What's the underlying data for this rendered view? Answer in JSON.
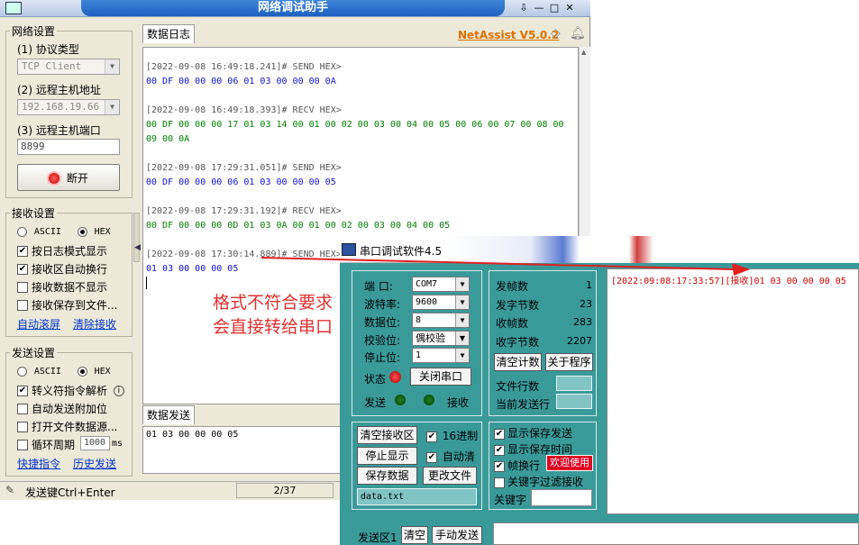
{
  "netassist": {
    "title": "网络调试助手",
    "brand": "NetAssist V5.0.2",
    "net_settings": {
      "label": "网络设置",
      "protocol_label": "(1) 协议类型",
      "protocol_value": "TCP Client",
      "host_label": "(2) 远程主机地址",
      "host_value": "192.168.19.66",
      "port_label": "(3) 远程主机端口",
      "port_value": "8899",
      "disconnect_label": "断开"
    },
    "recv_settings": {
      "label": "接收设置",
      "ascii": "ASCII",
      "hex": "HEX",
      "opt_log_mode": "按日志模式显示",
      "opt_auto_wrap": "接收区自动换行",
      "opt_no_display": "接收数据不显示",
      "opt_save_file": "接收保存到文件...",
      "link_auto_scroll": "自动滚屏",
      "link_clear": "清除接收"
    },
    "send_settings": {
      "label": "发送设置",
      "ascii": "ASCII",
      "hex": "HEX",
      "opt_escape": "转义符指令解析",
      "opt_append": "自动发送附加位",
      "opt_open_file": "打开文件数据源...",
      "opt_cycle": "循环周期",
      "cycle_value": "1000",
      "cycle_unit": "ms",
      "link_shortcut": "快捷指令",
      "link_history": "历史发送"
    },
    "log_tab": "数据日志",
    "log": [
      {
        "type": "hdr",
        "text": "[2022-09-08 16:49:18.241]# SEND HEX>"
      },
      {
        "type": "send",
        "text": "00 DF 00 00 00 06 01 03 00 00 00 0A"
      },
      {
        "type": "gap",
        "text": ""
      },
      {
        "type": "hdr",
        "text": "[2022-09-08 16:49:18.393]# RECV HEX>"
      },
      {
        "type": "recv",
        "text": "00 DF 00 00 00 17 01 03 14 00 01 00 02 00 03 00 04 00 05 00 06 00 07 00 08 00"
      },
      {
        "type": "recv",
        "text": "09 00 0A"
      },
      {
        "type": "gap",
        "text": ""
      },
      {
        "type": "hdr",
        "text": "[2022-09-08 17:29:31.051]# SEND HEX>"
      },
      {
        "type": "send",
        "text": "00 DF 00 00 00 06 01 03 00 00 00 05"
      },
      {
        "type": "gap",
        "text": ""
      },
      {
        "type": "hdr",
        "text": "[2022-09-08 17:29:31.192]# RECV HEX>"
      },
      {
        "type": "recv",
        "text": "00 DF 00 00 00 0D 01 03 0A 00 01 00 02 00 03 00 04 00 05"
      },
      {
        "type": "gap",
        "text": ""
      },
      {
        "type": "hdr",
        "text": "[2022-09-08 17:30:14.889]# SEND HEX>"
      },
      {
        "type": "send",
        "text": "01 03 00 00 00 05"
      }
    ],
    "send_tab": "数据发送",
    "send_text": "01 03 00 00 00 05",
    "status_hint": "发送键Ctrl+Enter",
    "status_count": "2/37"
  },
  "annotation": {
    "line1": "格式不符合要求",
    "line2": "会直接转给串口"
  },
  "serial": {
    "title": "串口调试软件4.5",
    "port_label": "端  口:",
    "port_value": "COM7",
    "baud_label": "波特率:",
    "baud_value": "9600",
    "databits_label": "数据位:",
    "databits_value": "8",
    "parity_label": "校验位:",
    "parity_value": "偶校验",
    "stopbits_label": "停止位:",
    "stopbits_value": "1",
    "state_label": "状态",
    "close_port": "关闭串口",
    "send_label": "发送",
    "recv_label": "接收",
    "stats": {
      "sent_frames_label": "发帧数",
      "sent_frames": "1",
      "sent_bytes_label": "发字节数",
      "sent_bytes": "23",
      "recv_frames_label": "收帧数",
      "recv_frames": "283",
      "recv_bytes_label": "收字节数",
      "recv_bytes": "2207",
      "clear_count": "清空计数",
      "about": "关于程序",
      "file_lines_label": "文件行数",
      "current_line_label": "当前发送行"
    },
    "buttons": {
      "clear_recv": "清空接收区",
      "stop_display": "停止显示",
      "save_data": "保存数据",
      "change_file": "更改文件",
      "hex16": "16进制",
      "auto_clear": "自动清",
      "file_name": "data.txt"
    },
    "options": {
      "show_save_send": "显示保存发送",
      "show_save_time": "显示保存时间",
      "frame_wrap": "帧换行",
      "welcome": "欢迎使用",
      "keyword_filter": "关键字过滤接收",
      "keyword_label": "关键字"
    },
    "recv_text": "[2022:09:08:17:33:57][接收]01 03 00 00 00 05",
    "send_area_label": "发送区1",
    "clear_btn": "清空",
    "manual_send": "手动发送"
  }
}
